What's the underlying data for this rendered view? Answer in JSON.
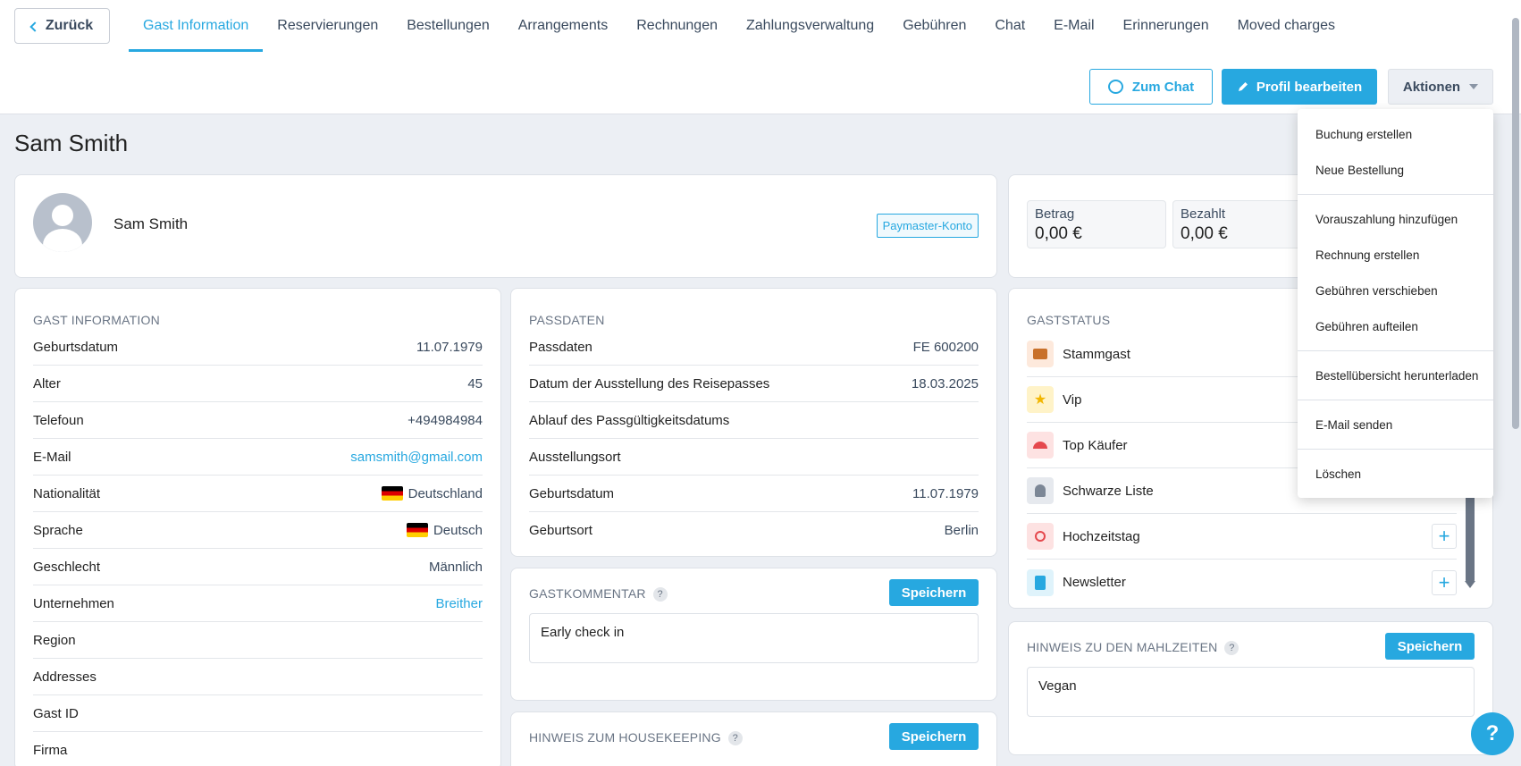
{
  "nav": {
    "back_label": "Zurück",
    "tabs": [
      "Gast Information",
      "Reservierungen",
      "Bestellungen",
      "Arrangements",
      "Rechnungen",
      "Zahlungsverwaltung",
      "Gebühren",
      "Chat",
      "E-Mail",
      "Erinnerungen",
      "Moved charges"
    ]
  },
  "actions": {
    "chat_label": "Zum Chat",
    "edit_label": "Profil bearbeiten",
    "actions_label": "Aktionen",
    "menu": [
      "Buchung erstellen",
      "Neue Bestellung",
      "Vorauszahlung hinzufügen",
      "Rechnung erstellen",
      "Gebühren verschieben",
      "Gebühren aufteilen",
      "Bestellübersicht herunterladen",
      "E-Mail senden",
      "Löschen"
    ]
  },
  "page_title": "Sam Smith",
  "profile": {
    "name": "Sam Smith",
    "badge": "Paymaster-Konto"
  },
  "amounts": {
    "betrag_label": "Betrag",
    "betrag_value": "0,00 €",
    "bezahlt_label": "Bezahlt",
    "bezahlt_value": "0,00 €"
  },
  "guest_info": {
    "title": "GAST INFORMATION",
    "rows": [
      {
        "k": "Geburtsdatum",
        "v": "11.07.1979"
      },
      {
        "k": "Alter",
        "v": "45"
      },
      {
        "k": "Telefoun",
        "v": "+494984984"
      },
      {
        "k": "E-Mail",
        "v": "samsmith@gmail.com"
      },
      {
        "k": "Nationalität",
        "v": "Deutschland"
      },
      {
        "k": "Sprache",
        "v": "Deutsch"
      },
      {
        "k": "Geschlecht",
        "v": "Männlich"
      },
      {
        "k": "Unternehmen",
        "v": "Breither"
      },
      {
        "k": "Region",
        "v": ""
      },
      {
        "k": "Addresses",
        "v": ""
      },
      {
        "k": "Gast ID",
        "v": ""
      },
      {
        "k": "Firma",
        "v": ""
      }
    ]
  },
  "passport": {
    "title": "PASSDATEN",
    "rows": [
      {
        "k": "Passdaten",
        "v": "FE 600200"
      },
      {
        "k": "Datum der Ausstellung des Reisepasses",
        "v": "18.03.2025"
      },
      {
        "k": "Ablauf des Passgültigkeitsdatums",
        "v": ""
      },
      {
        "k": "Ausstellungsort",
        "v": ""
      },
      {
        "k": "Geburtsdatum",
        "v": "11.07.1979"
      },
      {
        "k": "Geburtsort",
        "v": "Berlin"
      }
    ]
  },
  "comment": {
    "title": "GASTKOMMENTAR",
    "save": "Speichern",
    "text": "Early check in"
  },
  "housekeeping": {
    "title": "HINWEIS ZUM HOUSEKEEPING",
    "save": "Speichern"
  },
  "status": {
    "title": "GASTSTATUS",
    "items": [
      "Stammgast",
      "Vip",
      "Top Käufer",
      "Schwarze Liste",
      "Hochzeitstag",
      "Newsletter"
    ]
  },
  "meals": {
    "title": "HINWEIS ZU DEN MAHLZEITEN",
    "save": "Speichern",
    "text": "Vegan"
  },
  "help_label": "?",
  "colors": {
    "accent": "#27a8e0"
  }
}
